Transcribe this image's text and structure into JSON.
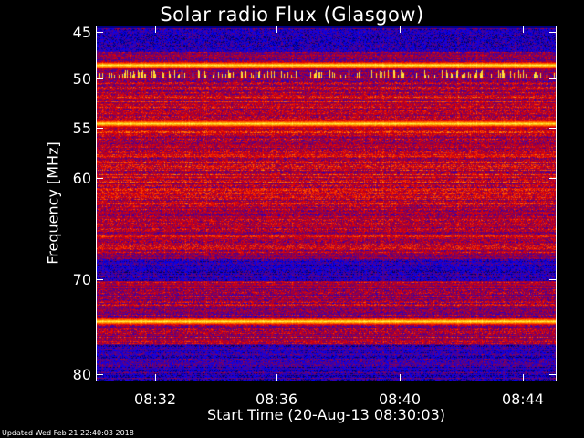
{
  "chart_data": {
    "type": "heatmap",
    "title": "Solar radio Flux (Glasgow)",
    "xlabel": "Start Time (20-Aug-13 08:30:03)",
    "ylabel": "Frequency [MHz]",
    "x_tick_labels": [
      "08:32",
      "08:36",
      "08:40",
      "08:44"
    ],
    "y_tick_labels": [
      "45",
      "50",
      "55",
      "60",
      "70",
      "80"
    ],
    "xlim": [
      "08:30:03",
      "08:45:10"
    ],
    "ylim": [
      45,
      80
    ],
    "colormap": [
      "#000044",
      "#0000ff",
      "#4b0090",
      "#9a0040",
      "#e00000",
      "#ff5000",
      "#ffb000",
      "#ffff60"
    ],
    "bright_bands_mhz": [
      48.8,
      54.6,
      74.2
    ],
    "bursty_bands_mhz": [
      50.1
    ],
    "low_intensity_bands_mhz": [
      [
        45.2,
        47.5
      ],
      [
        68.0,
        70.2
      ],
      [
        76.5,
        80.0
      ]
    ]
  },
  "footer": "Updated Wed Feb 21 22:40:03 2018"
}
